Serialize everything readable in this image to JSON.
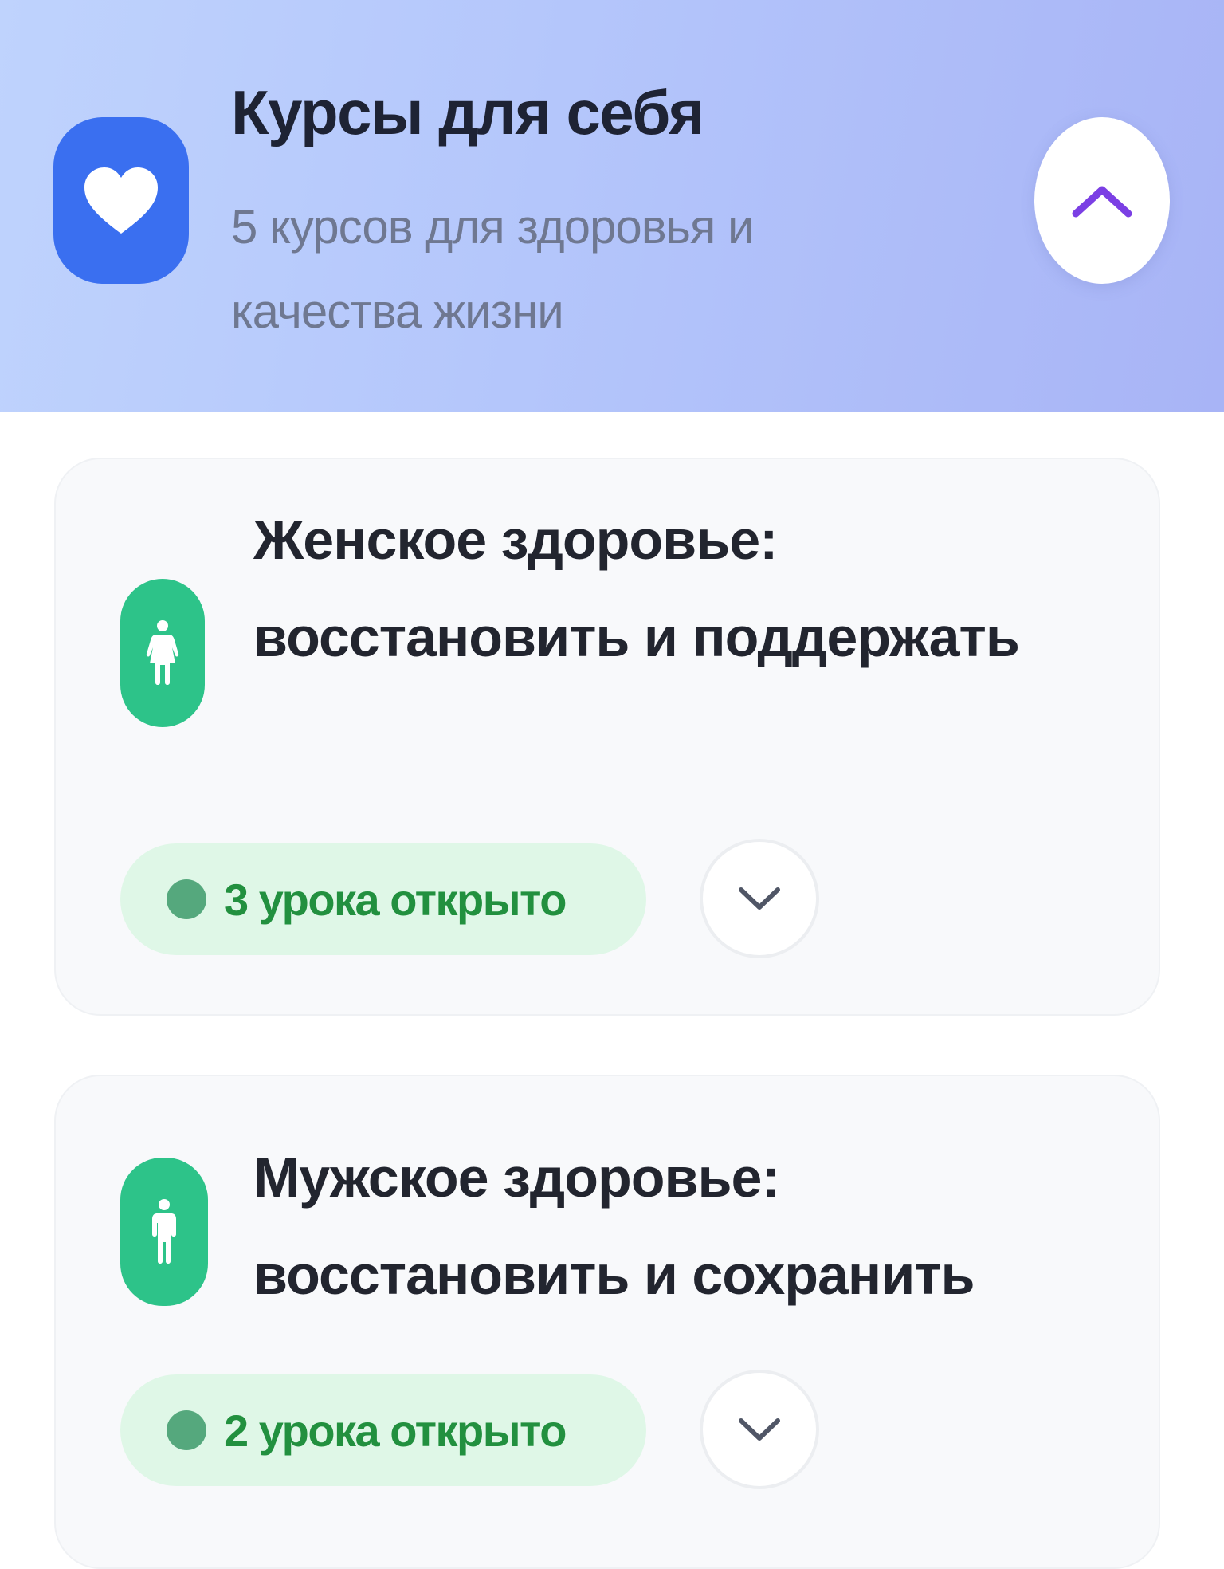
{
  "header": {
    "title": "Курсы для себя",
    "subtitle": "5 курсов для здоровья и качества жизни",
    "icon": "heart-icon",
    "collapse_icon": "chevron-up-icon",
    "colors": {
      "icon_bg": "#3a6ff0",
      "chevron": "#7b3fe4"
    }
  },
  "courses": [
    {
      "title": "Женское здоровье: восстановить и поддержать",
      "icon": "female-figure-icon",
      "lessons_badge": "3 урока открыто",
      "expand_icon": "chevron-down-icon"
    },
    {
      "title": "Мужское здоровье: восстановить и сохранить",
      "icon": "male-figure-icon",
      "lessons_badge": "2 урока открыто",
      "expand_icon": "chevron-down-icon"
    }
  ],
  "colors": {
    "course_icon_bg": "#2dc389",
    "badge_bg": "#dff7e7",
    "badge_text": "#22903f",
    "badge_dot": "#55a87d"
  }
}
